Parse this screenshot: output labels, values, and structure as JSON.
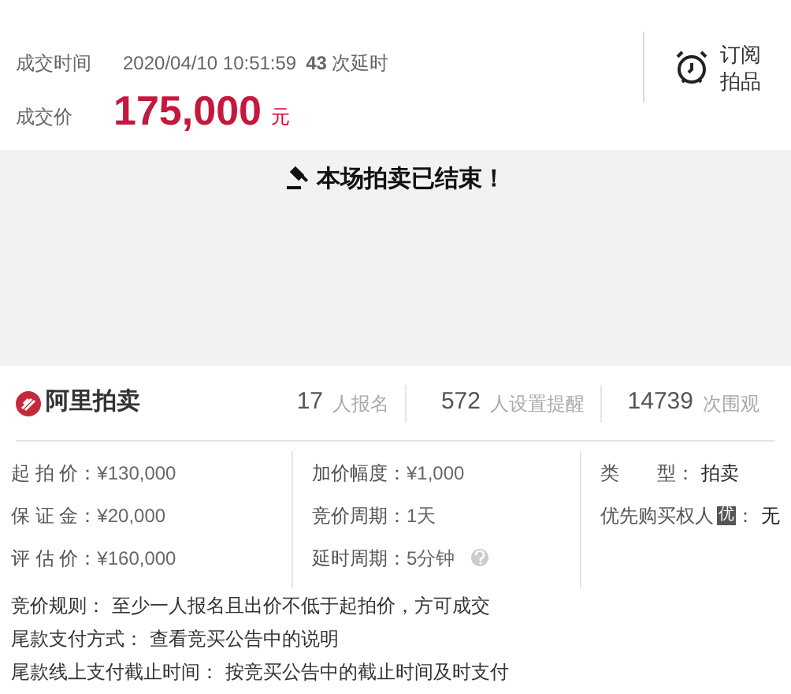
{
  "deal": {
    "time_label": "成交时间",
    "time": "2020/04/10 10:51:59",
    "extensions_count": "43",
    "extensions_label": "次延时",
    "price_label": "成交价",
    "price": "175,000",
    "currency": "元"
  },
  "subscribe": {
    "line_1": "订阅",
    "line_2": "拍品"
  },
  "banner": {
    "message": "本场拍卖已结束！"
  },
  "brand": {
    "name": "阿里拍卖"
  },
  "stats": [
    {
      "value": "17",
      "label": "人报名"
    },
    {
      "value": "572",
      "label": "人设置提醒"
    },
    {
      "value": "14739",
      "label": "次围观"
    }
  ],
  "details": [
    [
      {
        "label": "起 拍 价：",
        "value": "¥130,000"
      },
      {
        "label": "保 证 金：",
        "value": "¥20,000"
      },
      {
        "label": "评 估 价：",
        "value": "¥160,000"
      }
    ],
    [
      {
        "label": "加价幅度：",
        "value": "¥1,000"
      },
      {
        "label": "竞价周期：",
        "value": "1天"
      },
      {
        "label": "延时周期：",
        "value": "5分钟",
        "help": true
      }
    ],
    [
      {
        "label": "类　　型：",
        "value": "拍卖"
      },
      {
        "label": "优先购买权人",
        "badge": "优",
        "suffix": "：",
        "value": "无"
      }
    ]
  ],
  "rules": [
    {
      "label": "竞价规则：",
      "value": "至少一人报名且出价不低于起拍价，方可成交"
    },
    {
      "label": "尾款支付方式：",
      "value": "查看竞买公告中的说明"
    },
    {
      "label": "尾款线上支付截止时间：",
      "value": "按竞买公告中的截止时间及时支付"
    }
  ]
}
